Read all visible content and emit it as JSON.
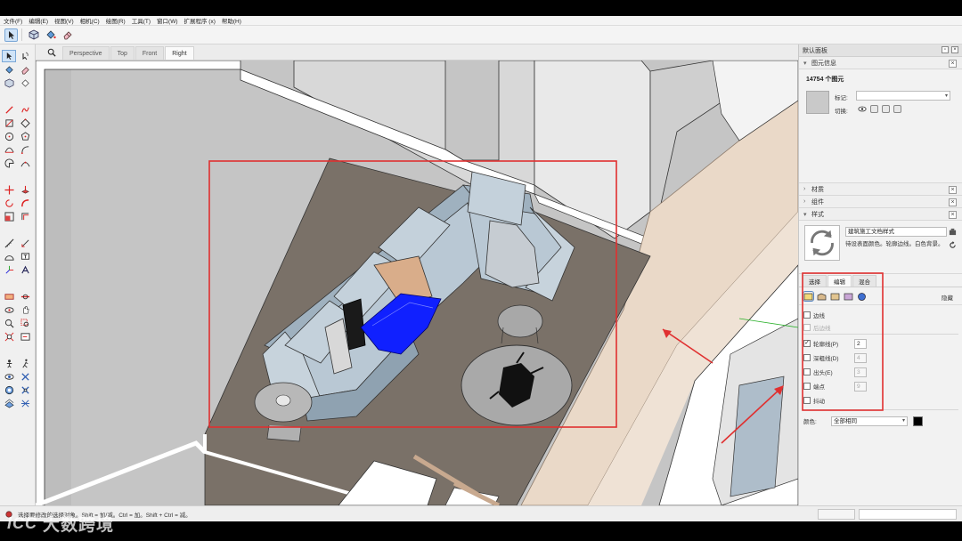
{
  "menu": [
    "文件(F)",
    "编辑(E)",
    "视图(V)",
    "相机(C)",
    "绘图(R)",
    "工具(T)",
    "窗口(W)",
    "扩展程序 (x)",
    "帮助(H)"
  ],
  "scene_tabs": [
    "Perspective",
    "Top",
    "Front",
    "Right"
  ],
  "selected_scene_tab": "Right",
  "status": {
    "hint": "选择要修改的选择对象。Shift = 加/减。Ctrl = 加。Shift + Ctrl = 减。"
  },
  "watermark": {
    "logo": "ICC",
    "text": "大数跨境"
  },
  "panel": {
    "title": "默认面板",
    "entity_info": {
      "heading": "图元信息",
      "count": "14754 个图元",
      "tag_label": "标记:",
      "toggle_label": "切换:"
    },
    "materials_heading": "材质",
    "components_heading": "组件",
    "styles": {
      "heading": "样式",
      "name": "建筑施工文档样式",
      "description": "待设表面颜色。轮廓边线。白色背景。",
      "tabs": [
        "选择",
        "编辑",
        "混合"
      ],
      "selected_tab": "编辑",
      "sync_label": "隐藏"
    },
    "edge_options": [
      {
        "label": "边线",
        "checked": false,
        "value": "",
        "disabled": false
      },
      {
        "label": "后边线",
        "checked": false,
        "value": "",
        "disabled": true
      },
      {
        "label": "轮廓线(P)",
        "checked": true,
        "value": "2",
        "disabled": false
      },
      {
        "label": "深粗线(D)",
        "checked": false,
        "value": "4",
        "disabled": false
      },
      {
        "label": "出头(E)",
        "checked": false,
        "value": "3",
        "disabled": false
      },
      {
        "label": "端点",
        "checked": false,
        "value": "9",
        "disabled": false
      },
      {
        "label": "抖动",
        "checked": false,
        "value": "",
        "disabled": false
      }
    ],
    "color": {
      "label": "颜色:",
      "value": "全部相同",
      "swatch": "#000000"
    }
  },
  "colors": {
    "highlight_red": "#e03030",
    "selection_blue": "#1020ff",
    "sofa": "#b9c8d4",
    "rug": "#7a7168",
    "floor_tile": "#ead9c8"
  }
}
